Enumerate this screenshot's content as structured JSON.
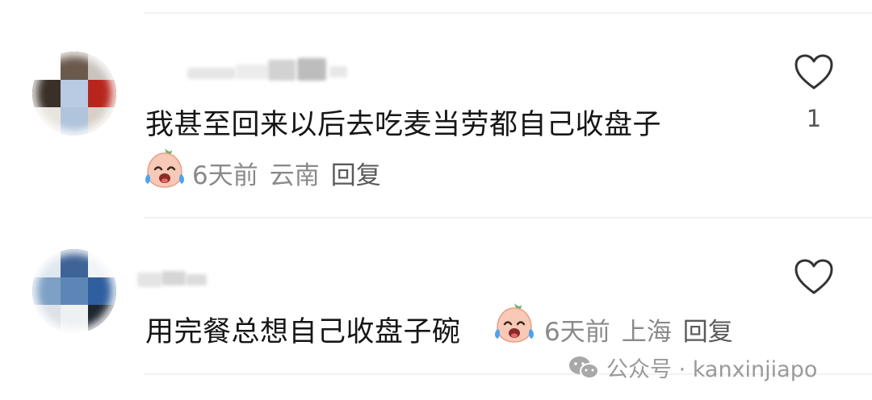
{
  "comments": [
    {
      "text": "我甚至回来以后去吃麦当劳都自己收盘子",
      "time": "6天前",
      "location": "云南",
      "reply_label": "回复",
      "like_count": "1",
      "avatar_colors": [
        "#ffffff",
        "#6b5a4c",
        "#c9c3bd",
        "#3a3028",
        "#b9cbe3",
        "#b8251c",
        "#e8e4de",
        "#b0c4dc",
        "#d8d0c8"
      ]
    },
    {
      "text": "用完餐总想自己收盘子碗",
      "time": "6天前",
      "location": "上海",
      "reply_label": "回复",
      "like_count": "",
      "avatar_colors": [
        "#dfe7ef",
        "#3e6396",
        "#f1f3f6",
        "#7ea0c6",
        "#5d86b7",
        "#2f5f9e",
        "#dde2e8",
        "#eef1f4",
        "#1f2630"
      ]
    }
  ],
  "watermark": {
    "text": "公众号 · kanxinjiapo"
  },
  "colors": {
    "text_primary": "#161616",
    "text_secondary": "#8a8a8a",
    "divider": "#f2f2f2"
  },
  "icons": {
    "like": "heart-outline-icon",
    "sticker": "laughing-crying-peach-sticker",
    "watermark": "wechat-icon"
  }
}
